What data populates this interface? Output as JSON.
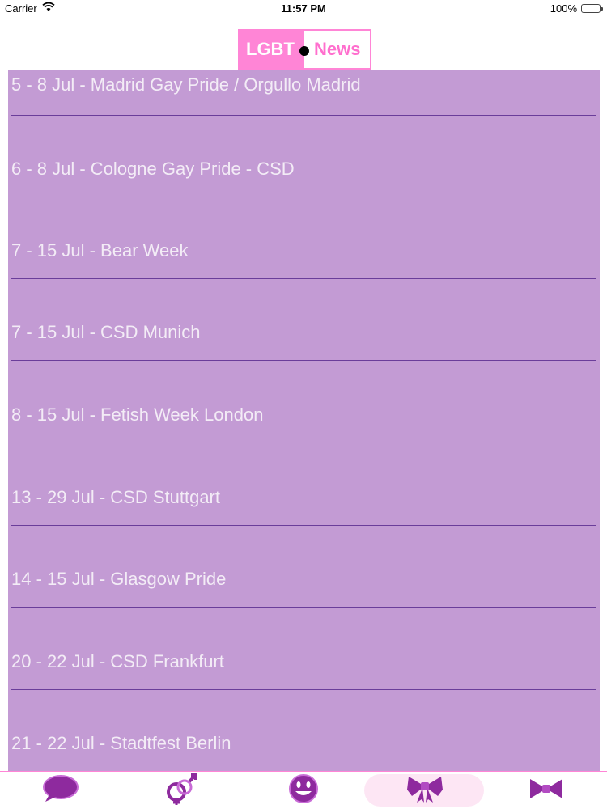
{
  "status": {
    "carrier": "Carrier",
    "time": "11:57 PM",
    "battery": "100%"
  },
  "header": {
    "logo_left": "LGBT",
    "logo_right": "News"
  },
  "events": [
    "5 - 8 Jul - Madrid Gay Pride / Orgullo Madrid",
    "6 - 8 Jul - Cologne Gay Pride - CSD",
    "7 - 15 Jul - Bear Week",
    "7 - 15 Jul - CSD Munich",
    "8 - 15 Jul - Fetish Week London",
    "13 - 29 Jul - CSD Stuttgart",
    "14 - 15 Jul - Glasgow Pride",
    "20 - 22 Jul - CSD Frankfurt",
    "21 - 22 Jul - Stadtfest Berlin"
  ],
  "tabs": [
    {
      "icon": "speech-bubble-icon"
    },
    {
      "icon": "gender-symbols-icon"
    },
    {
      "icon": "smiley-icon"
    },
    {
      "icon": "bow-tie-icon",
      "active": true
    },
    {
      "icon": "bow-tie-outline-icon"
    }
  ],
  "colors": {
    "accent": "#ff85d6",
    "list_bg": "#c39bd4",
    "separator": "#6a3d9a",
    "icon": "#8e2a9e"
  }
}
